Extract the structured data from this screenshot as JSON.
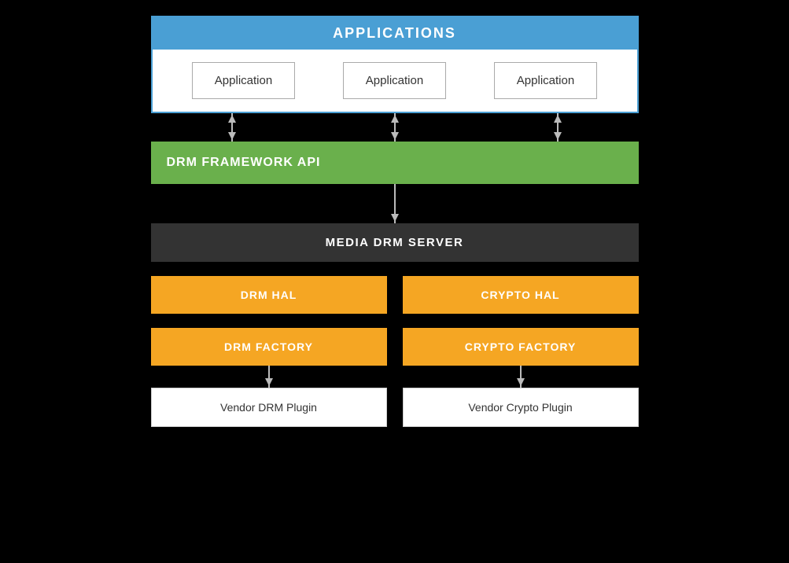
{
  "applications": {
    "header": "APPLICATIONS",
    "apps": [
      {
        "label": "Application"
      },
      {
        "label": "Application"
      },
      {
        "label": "Application"
      }
    ]
  },
  "drm_framework": {
    "label": "DRM FRAMEWORK API"
  },
  "media_drm": {
    "label": "MEDIA DRM SERVER"
  },
  "hal_row": {
    "left": "DRM HAL",
    "right": "CRYPTO HAL"
  },
  "factory_row": {
    "left": "DRM FACTORY",
    "right": "CRYPTO FACTORY"
  },
  "vendor_row": {
    "left": "Vendor DRM Plugin",
    "right": "Vendor Crypto Plugin"
  },
  "colors": {
    "blue": "#4a9fd4",
    "green": "#6ab04c",
    "orange": "#f5a623",
    "dark": "#333333",
    "white": "#ffffff"
  }
}
